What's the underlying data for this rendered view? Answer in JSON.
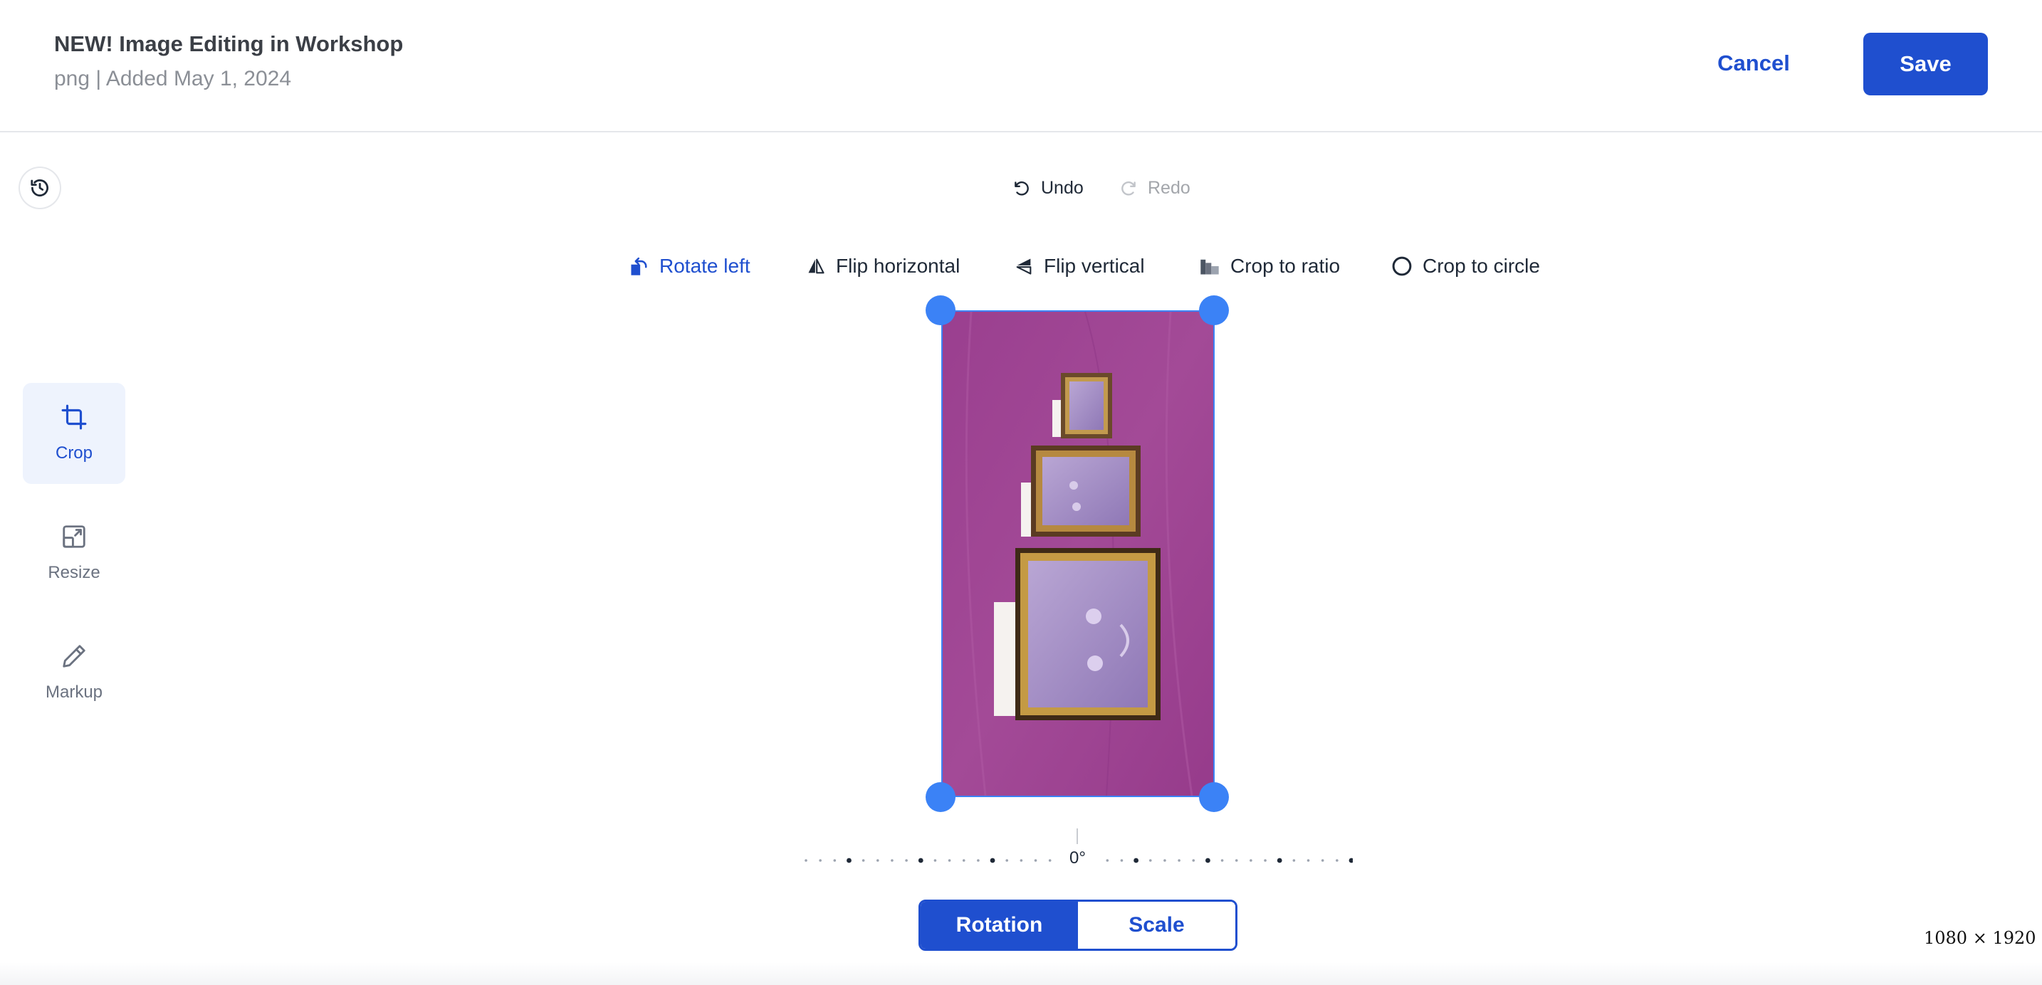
{
  "header": {
    "title": "NEW! Image Editing in Workshop",
    "subtitle": "png | Added May 1, 2024",
    "cancel_label": "Cancel",
    "save_label": "Save"
  },
  "history": {
    "icon": "history-icon"
  },
  "edit_actions": {
    "undo_label": "Undo",
    "redo_label": "Redo"
  },
  "toolbar": {
    "items": [
      {
        "label": "Rotate left",
        "icon": "rotate-left-icon",
        "active": true
      },
      {
        "label": "Flip horizontal",
        "icon": "flip-horizontal-icon",
        "active": false
      },
      {
        "label": "Flip vertical",
        "icon": "flip-vertical-icon",
        "active": false
      },
      {
        "label": "Crop to ratio",
        "icon": "crop-ratio-icon",
        "active": false
      },
      {
        "label": "Crop to circle",
        "icon": "crop-circle-icon",
        "active": false
      }
    ]
  },
  "sidebar": {
    "items": [
      {
        "label": "Crop",
        "icon": "crop-icon",
        "active": true
      },
      {
        "label": "Resize",
        "icon": "resize-icon",
        "active": false
      },
      {
        "label": "Markup",
        "icon": "pencil-icon",
        "active": false
      }
    ]
  },
  "rotation": {
    "value_label": "0°"
  },
  "mode": {
    "rotation_label": "Rotation",
    "scale_label": "Scale",
    "selected": "Rotation"
  },
  "image": {
    "dimensions_label": "1080 × 1920",
    "background_color": "#9b4490"
  },
  "colors": {
    "accent": "#1f4fcf",
    "handle": "#3b82f6"
  }
}
